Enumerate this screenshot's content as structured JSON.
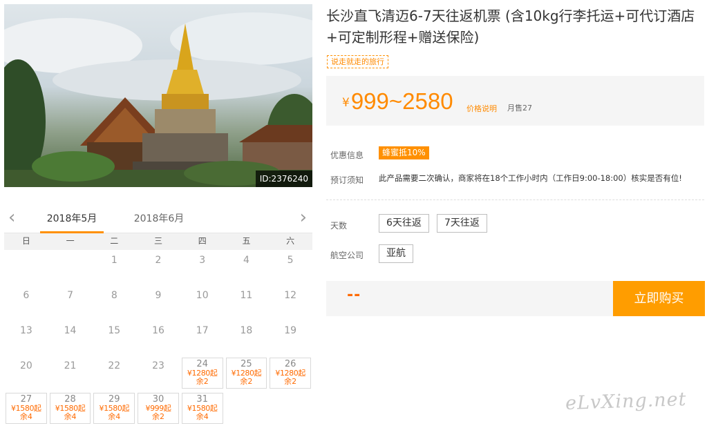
{
  "image": {
    "id_label": "ID:2376240"
  },
  "product": {
    "title": "长沙直飞清迈6-7天往返机票 (含10kg行李托运+可代订酒店+可定制形程+赠送保险)",
    "tag": "说走就走的旅行",
    "price_symbol": "¥",
    "price_range": "999~2580",
    "price_note": "价格说明",
    "monthly_sales": "月售27"
  },
  "promo": {
    "label": "优惠信息",
    "badge": "蜂蜜抵10%"
  },
  "booking_notice": {
    "label": "预订须知",
    "text": "此产品需要二次确认，商家将在18个工作小时内（工作日9:00-18:00）核实是否有位!"
  },
  "options": {
    "days_label": "天数",
    "days": [
      "6天往返",
      "7天往返"
    ],
    "airline_label": "航空公司",
    "airlines": [
      "亚航"
    ]
  },
  "purchase": {
    "total": "--",
    "buy_label": "立即购买"
  },
  "calendar": {
    "prev_icon": "chevron-left-icon",
    "next_icon": "chevron-right-icon",
    "prev_glyph": "‹",
    "next_glyph": "›",
    "months": [
      "2018年5月",
      "2018年6月"
    ],
    "active_month": "2018年5月",
    "weekdays": [
      "日",
      "一",
      "二",
      "三",
      "四",
      "五",
      "六"
    ],
    "leading_blanks": 2,
    "days": [
      {
        "day": "1"
      },
      {
        "day": "2"
      },
      {
        "day": "3"
      },
      {
        "day": "4"
      },
      {
        "day": "5"
      },
      {
        "day": "6"
      },
      {
        "day": "7"
      },
      {
        "day": "8"
      },
      {
        "day": "9"
      },
      {
        "day": "10"
      },
      {
        "day": "11"
      },
      {
        "day": "12"
      },
      {
        "day": "13"
      },
      {
        "day": "14"
      },
      {
        "day": "15"
      },
      {
        "day": "16"
      },
      {
        "day": "17"
      },
      {
        "day": "18"
      },
      {
        "day": "19"
      },
      {
        "day": "20"
      },
      {
        "day": "21"
      },
      {
        "day": "22"
      },
      {
        "day": "23"
      },
      {
        "day": "24",
        "price": "¥1280起",
        "stock": "余2"
      },
      {
        "day": "25",
        "price": "¥1280起",
        "stock": "余2"
      },
      {
        "day": "26",
        "price": "¥1280起",
        "stock": "余2"
      },
      {
        "day": "27",
        "price": "¥1580起",
        "stock": "余4"
      },
      {
        "day": "28",
        "price": "¥1580起",
        "stock": "余4"
      },
      {
        "day": "29",
        "price": "¥1580起",
        "stock": "余4"
      },
      {
        "day": "30",
        "price": "¥999起",
        "stock": "余2"
      },
      {
        "day": "31",
        "price": "¥1580起",
        "stock": "余4"
      }
    ]
  },
  "watermark": "eLvXing.net",
  "colors": {
    "accent": "#ff9000",
    "price": "#ff8a00",
    "buy_button": "#ff9d00"
  }
}
